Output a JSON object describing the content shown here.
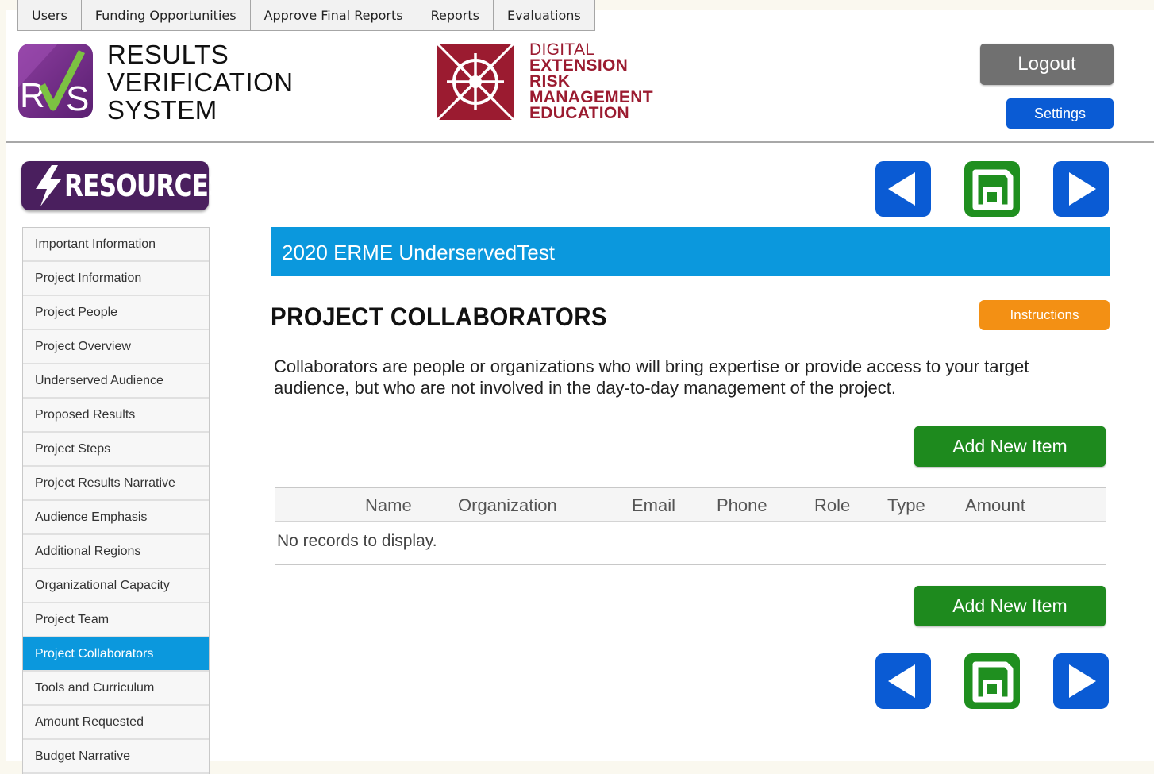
{
  "top_nav": [
    "Users",
    "Funding Opportunities",
    "Approve Final Reports",
    "Reports",
    "Evaluations"
  ],
  "header": {
    "rvs_logo_text": "RVS",
    "rvs_title_lines": [
      "RESULTS",
      "VERIFICATION",
      "SYSTEM"
    ],
    "derme_lines": [
      "DIGITAL",
      "EXTENSION",
      "RISK",
      "MANAGEMENT",
      "EDUCATION"
    ],
    "logout_label": "Logout",
    "settings_label": "Settings"
  },
  "resources_label": "RESOURCES",
  "sidebar": {
    "items": [
      "Important Information",
      "Project Information",
      "Project People",
      "Project Overview",
      "Underserved Audience",
      "Proposed Results",
      "Project Steps",
      "Project Results Narrative",
      "Audience Emphasis",
      "Additional Regions",
      "Organizational Capacity",
      "Project Team",
      "Project Collaborators",
      "Tools and Curriculum",
      "Amount Requested",
      "Budget Narrative"
    ],
    "active_index": 12
  },
  "nav_icons": {
    "back": "back-arrow-icon",
    "save": "floppy-disk-icon",
    "forward": "forward-arrow-icon"
  },
  "main": {
    "banner": "2020 ERME UnderservedTest",
    "page_title": "PROJECT COLLABORATORS",
    "instructions_label": "Instructions",
    "description": "Collaborators are people or organizations who will bring expertise or provide access to your target audience, but who are not involved in the day-to-day management of the project.",
    "add_label": "Add New Item",
    "table": {
      "columns": [
        "Name",
        "Organization",
        "Email",
        "Phone",
        "Role",
        "Type",
        "Amount"
      ],
      "empty_text": "No records to display."
    }
  },
  "colors": {
    "banner_blue": "#0b98dd",
    "nav_blue": "#0a5bd4",
    "save_green": "#1f8f1f",
    "instructions_orange": "#f39014",
    "resources_purple": "#4a1f5e",
    "derme_red": "#9b1b30",
    "logout_gray": "#707070"
  }
}
